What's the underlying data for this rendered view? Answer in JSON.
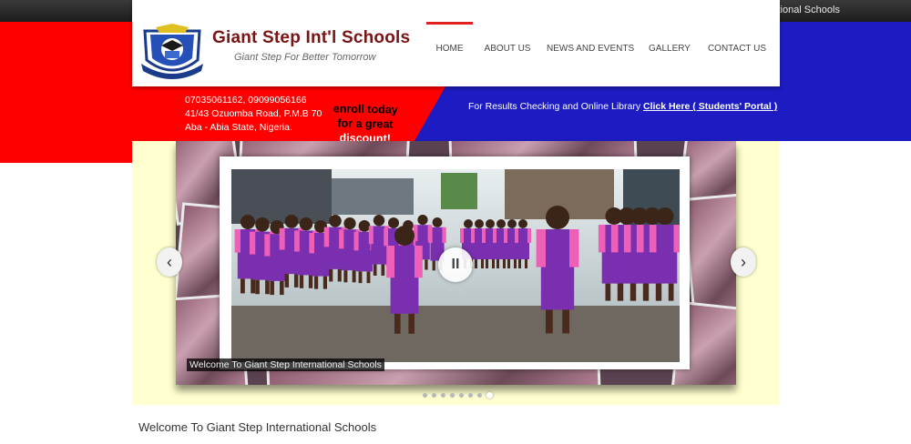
{
  "marquee": {
    "text": "Welcome To Giant Step International Schools"
  },
  "header": {
    "school_name": "Giant Step Int'l Schools",
    "tagline": "Giant Step For Better Tomorrow"
  },
  "nav": {
    "items": [
      {
        "label": "HOME",
        "active": true
      },
      {
        "label": "ABOUT US",
        "active": false
      },
      {
        "label": "NEWS AND EVENTS",
        "active": false
      },
      {
        "label": "GALLERY",
        "active": false
      },
      {
        "label": "CONTACT US",
        "active": false
      }
    ]
  },
  "contact": {
    "phones": "07035061162, 09099056166",
    "address_line1": "41/43 Ozuomba Road, P.M.B 70",
    "address_line2": "Aba - Abia State, Nigeria."
  },
  "promo": {
    "line1": "enroll today",
    "line2": "for a great",
    "line3": "discount!"
  },
  "portal": {
    "text": "For Results Checking and Online Library",
    "link": "Click Here ( Students' Portal )"
  },
  "slider": {
    "caption": "Welcome To Giant Step International Schools",
    "pause_symbol": "II",
    "prev_symbol": "‹",
    "next_symbol": "›",
    "slide_count": 8,
    "active_slide": 8
  },
  "content": {
    "welcome_title": "Welcome To Giant Step International Schools"
  },
  "colors": {
    "red": "#ff0000",
    "blue": "#1c1cc2",
    "maroon": "#7a1414",
    "nav_active": "#e02020"
  },
  "icons": [
    "crest-logo-icon",
    "pause-icon",
    "chevron-left-icon",
    "chevron-right-icon"
  ]
}
